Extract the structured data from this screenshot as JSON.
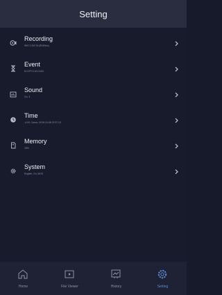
{
  "header": {
    "title": "Setting"
  },
  "settings": [
    {
      "label": "Recording",
      "sub": "WIG 2:1M S4 (8S/64sc)",
      "icon": "recording-icon"
    },
    {
      "label": "Event",
      "sub": "M-OFF,G-M-CAS3",
      "icon": "event-icon"
    },
    {
      "label": "Sound",
      "sub": "On, 3",
      "icon": "sound-icon"
    },
    {
      "label": "Time",
      "sub": "-4:00, Canco, 2018-10-08 22:37:13",
      "icon": "clock-icon"
    },
    {
      "label": "Memory",
      "sub": "18%",
      "icon": "memory-icon"
    },
    {
      "label": "System",
      "sub": "English, On, MGS",
      "icon": "gear-icon"
    }
  ],
  "tabs": [
    {
      "label": "Home",
      "icon": "home-icon",
      "active": false
    },
    {
      "label": "File Viewer",
      "icon": "file-viewer-icon",
      "active": false
    },
    {
      "label": "History",
      "icon": "history-icon",
      "active": false
    },
    {
      "label": "Setting",
      "icon": "settings-icon",
      "active": true
    }
  ],
  "colors": {
    "accent": "#5b8bd6",
    "background": "#181b2c",
    "header": "#2a2d40"
  }
}
